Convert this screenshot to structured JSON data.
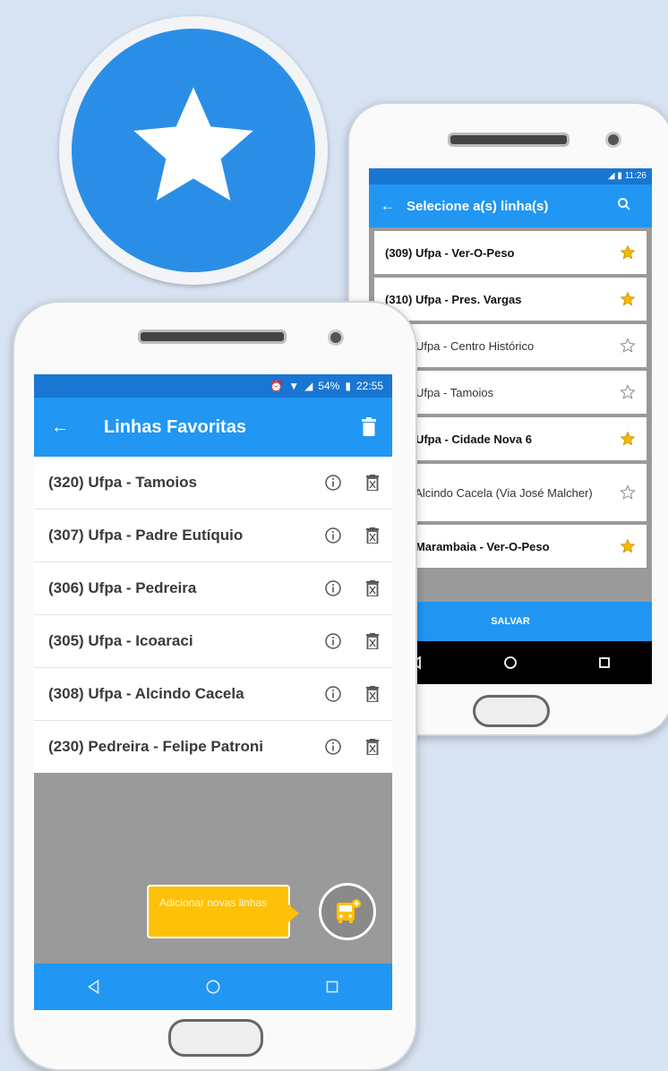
{
  "back_screen": {
    "status_time": "11:26",
    "title": "Selecione a(s) linha(s)",
    "items": [
      {
        "label": "(309) Ufpa - Ver-O-Peso",
        "favorite": true
      },
      {
        "label": "(310) Ufpa - Pres. Vargas",
        "favorite": true
      },
      {
        "label": "(306) Ufpa - Centro Histórico",
        "favorite": false
      },
      {
        "label": "(320) Ufpa - Tamoios",
        "favorite": false
      },
      {
        "label": "(301) Ufpa - Cidade Nova 6",
        "favorite": true
      },
      {
        "label": "(307) Alcindo Cacela (Via José Malcher)",
        "favorite": false
      },
      {
        "label": "(308) Marambaia - Ver-O-Peso",
        "favorite": true
      }
    ],
    "save_label": "SALVAR"
  },
  "front_screen": {
    "status_battery": "54%",
    "status_time": "22:55",
    "title": "Linhas Favoritas",
    "items": [
      {
        "label": "(320) Ufpa - Tamoios"
      },
      {
        "label": "(307) Ufpa - Padre Eutíquio"
      },
      {
        "label": "(306) Ufpa - Pedreira"
      },
      {
        "label": "(305) Ufpa - Icoaraci"
      },
      {
        "label": "(308) Ufpa - Alcindo Cacela"
      },
      {
        "label": "(230) Pedreira - Felipe Patroni"
      }
    ],
    "tooltip": "Adicionar novas linhas"
  },
  "colors": {
    "primary": "#2196f3",
    "primary_dark": "#1976d2",
    "accent": "#ffc107",
    "star_favorite": "#f5b800"
  }
}
